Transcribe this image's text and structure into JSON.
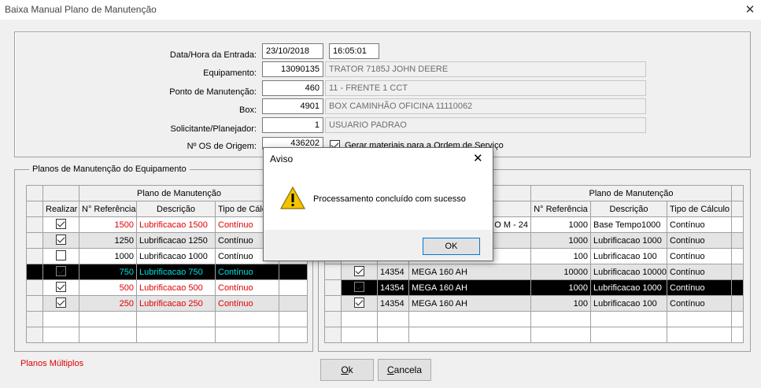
{
  "window": {
    "title": "Baixa Manual Plano de Manutenção",
    "close_glyph": "✕"
  },
  "header": {
    "date_label": "Data/Hora da Entrada:",
    "date_value": "23/10/2018",
    "time_value": "16:05:01",
    "equip_label": "Equipamento:",
    "equip_code": "13090135",
    "equip_desc": "TRATOR 7185J JOHN DEERE",
    "ponto_label": "Ponto de Manutenção:",
    "ponto_code": "460",
    "ponto_desc": "11 - FRENTE 1 CCT",
    "box_label": "Box:",
    "box_code": "4901",
    "box_desc": "BOX CAMINHÃO OFICINA 11110062",
    "sol_label": "Solicitante/Planejador:",
    "sol_code": "1",
    "sol_desc": "USUARIO PADRAO",
    "os_label": "Nº OS de Origem:",
    "os_value": "436202",
    "gerar_label": "Gerar materiais para a Ordem de Serviço",
    "gerar_checked": true
  },
  "group_left": {
    "title": "Planos de Manutenção do Equipamento",
    "band_header": "Plano de Manutenção",
    "columns": [
      "Realizar",
      "N° Referência",
      "Descrição",
      "Tipo de Cálculo"
    ],
    "rows": [
      {
        "checked": true,
        "ref": "1500",
        "desc": "Lubrificacao 1500",
        "tipo": "Contínuo",
        "style": "red"
      },
      {
        "checked": true,
        "ref": "1250",
        "desc": "Lubrificacao 1250",
        "tipo": "Contínuo",
        "style": "alt"
      },
      {
        "checked": false,
        "ref": "1000",
        "desc": "Lubrificacao 1000",
        "tipo": "Contínuo",
        "style": ""
      },
      {
        "checked": true,
        "ref": "750",
        "desc": "Lubrificacao 750",
        "tipo": "Contínuo",
        "style": "dark"
      },
      {
        "checked": true,
        "ref": "500",
        "desc": "Lubrificacao 500",
        "tipo": "Contínuo",
        "style": "red"
      },
      {
        "checked": true,
        "ref": "250",
        "desc": "Lubrificacao 250",
        "tipo": "Contínuo",
        "style": "red alt"
      }
    ]
  },
  "group_right": {
    "band_header": "Plano de Manutenção",
    "columns": [
      "N° Referência",
      "Descrição",
      "Tipo de Cálculo"
    ],
    "rows": [
      {
        "checked": true,
        "code": "",
        "equip": "O M - 24",
        "ref": "1000",
        "desc": "Base Tempo1000",
        "tipo": "Contínuo",
        "style": ""
      },
      {
        "checked": true,
        "code": "",
        "equip": "",
        "ref": "1000",
        "desc": "Lubrificacao 1000",
        "tipo": "Contínuo",
        "style": "alt"
      },
      {
        "checked": true,
        "code": "",
        "equip": "",
        "ref": "100",
        "desc": "Lubrificacao 100",
        "tipo": "Contínuo",
        "style": ""
      },
      {
        "checked": true,
        "code": "14354",
        "equip": "MEGA 160 AH",
        "ref": "10000",
        "desc": "Lubrificacao 10000",
        "tipo": "Contínuo",
        "style": "alt"
      },
      {
        "checked": true,
        "code": "14354",
        "equip": "MEGA 160 AH",
        "ref": "1000",
        "desc": "Lubrificacao 1000",
        "tipo": "Contínuo",
        "style": "dark"
      },
      {
        "checked": true,
        "code": "14354",
        "equip": "MEGA 160 AH",
        "ref": "100",
        "desc": "Lubrificacao 100",
        "tipo": "Contínuo",
        "style": "alt"
      }
    ]
  },
  "footer": {
    "planos_multiplos": "Planos Múltiplos",
    "ok_label": "Ok",
    "ok_key": "O",
    "ok_rest": "k",
    "cancel_key": "C",
    "cancel_rest": "ancela",
    "accent_red": "#e00000"
  },
  "dialog": {
    "title": "Aviso",
    "message": "Processamento concluído com sucesso",
    "ok": "OK",
    "icon": "warning-icon"
  }
}
